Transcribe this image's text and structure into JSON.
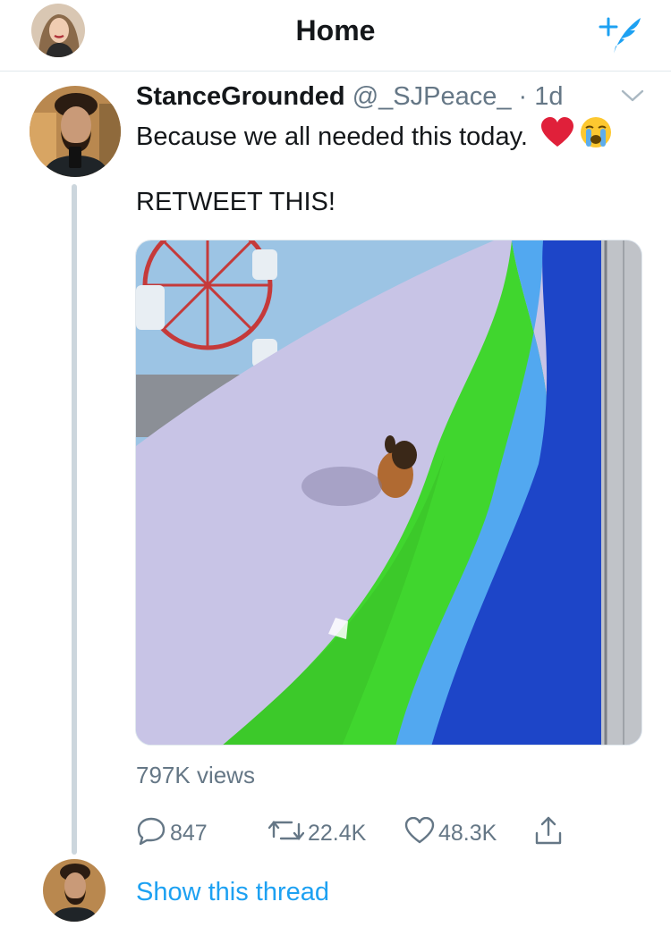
{
  "header": {
    "title": "Home",
    "profile_icon": "user-avatar",
    "compose_icon": "compose-tweet-icon",
    "accent_color": "#1da1f2"
  },
  "tweet": {
    "display_name": "StanceGrounded",
    "handle_and_time": "@_SJPeace_ · 1d",
    "text_line1": "Because we all needed this today.",
    "emojis": [
      "red-heart-emoji",
      "loudly-crying-face-emoji"
    ],
    "text_line2": "RETWEET THIS!",
    "media_icon": "video-thumbnail",
    "views": "797K views",
    "replies": "847",
    "retweets": "22.4K",
    "likes": "48.3K"
  },
  "footer": {
    "show_thread": "Show this thread"
  }
}
